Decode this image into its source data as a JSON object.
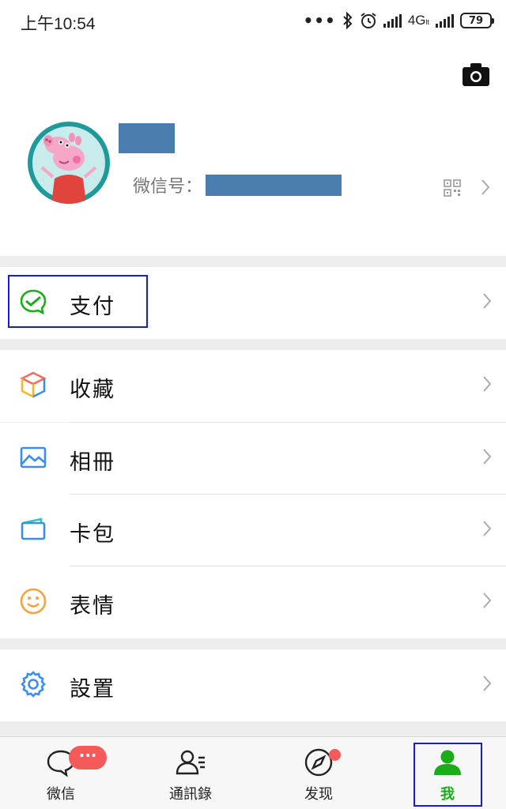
{
  "status_bar": {
    "time": "上午10:54",
    "network": "4G",
    "network_sub": "lt",
    "battery": "79"
  },
  "profile": {
    "wechat_id_label": "微信号："
  },
  "menu": {
    "pay": "支付",
    "favorites": "收藏",
    "album": "相冊",
    "cards": "卡包",
    "stickers": "表情",
    "settings": "設置"
  },
  "tabs": [
    {
      "label": "微信",
      "icon": "chat-icon",
      "badge": "···"
    },
    {
      "label": "通訊錄",
      "icon": "contacts-icon"
    },
    {
      "label": "发现",
      "icon": "compass-icon"
    },
    {
      "label": "我",
      "icon": "person-icon",
      "active": true
    }
  ],
  "colors": {
    "accent_green": "#1aad19",
    "badge_red": "#f55a5a",
    "redaction": "#4a7dad",
    "highlight_box": "#1a1adc"
  }
}
